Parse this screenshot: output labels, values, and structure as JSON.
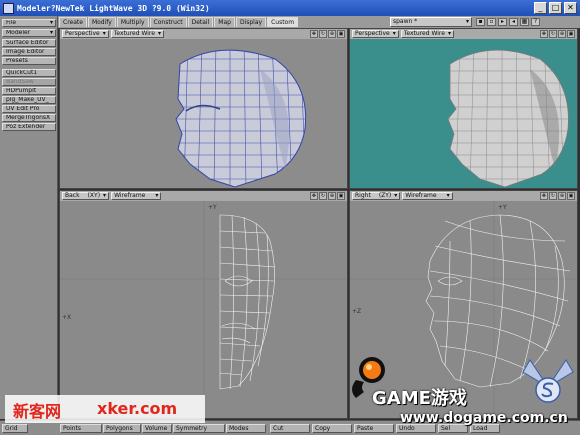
{
  "window": {
    "title": "Modeler?NewTek LightWave 3D ?9.0 (Win32)",
    "minimize": "_",
    "maximize": "□",
    "close": "✕"
  },
  "sidebar": {
    "items": [
      {
        "label": "File",
        "dropdown": true
      },
      {
        "label": "Modeler",
        "dropdown": true
      },
      {
        "label": "Surface Editor"
      },
      {
        "label": "Image Editor"
      },
      {
        "label": "Presets"
      },
      {
        "label": "QuickCut1"
      },
      {
        "label": "BandSaw",
        "disabled": true
      },
      {
        "label": "HDPumpIt"
      },
      {
        "label": "plg_Make_UV_"
      },
      {
        "label": "UV Edit Pro"
      },
      {
        "label": "MergeTrigonsX"
      },
      {
        "label": "Poz Extender"
      }
    ]
  },
  "tabs": [
    "Create",
    "Modify",
    "Multiply",
    "Construct",
    "Detail",
    "Map",
    "Display",
    "Custom"
  ],
  "active_tab": "Custom",
  "layer_select": {
    "value": "spawn *"
  },
  "viewports": [
    {
      "projection": "Perspective",
      "render": "Textured Wire",
      "bg": "#8c8c8c"
    },
    {
      "projection": "Perspective",
      "render": "Textured Wire",
      "bg": "#3a8e8c"
    },
    {
      "projection": "Back",
      "axes": "(XY)",
      "render": "Wireframe",
      "bg": "#8a8a8a",
      "axis_label": "+Y",
      "side_label": "+X"
    },
    {
      "projection": "Right",
      "axes": "(ZY)",
      "render": "Wireframe",
      "bg": "#8a8a8a",
      "axis_label": "+Y",
      "side_label": "+Z"
    }
  ],
  "bottom": {
    "grid": "Grid",
    "points": "Points",
    "polygons": "Polygons",
    "volume": "Volume",
    "symmetry": "Symmetry",
    "modes": "Modes",
    "cut": "Cut",
    "copy": "Copy",
    "paste": "Paste",
    "undo": "Undo",
    "sel": "Sel",
    "load": "Load"
  },
  "watermark": {
    "left_cn": "新客网",
    "left_en": "xker.com",
    "game": "GAME游戏",
    "url": "www.dogame.com.cn",
    "color": "#e1261c"
  }
}
